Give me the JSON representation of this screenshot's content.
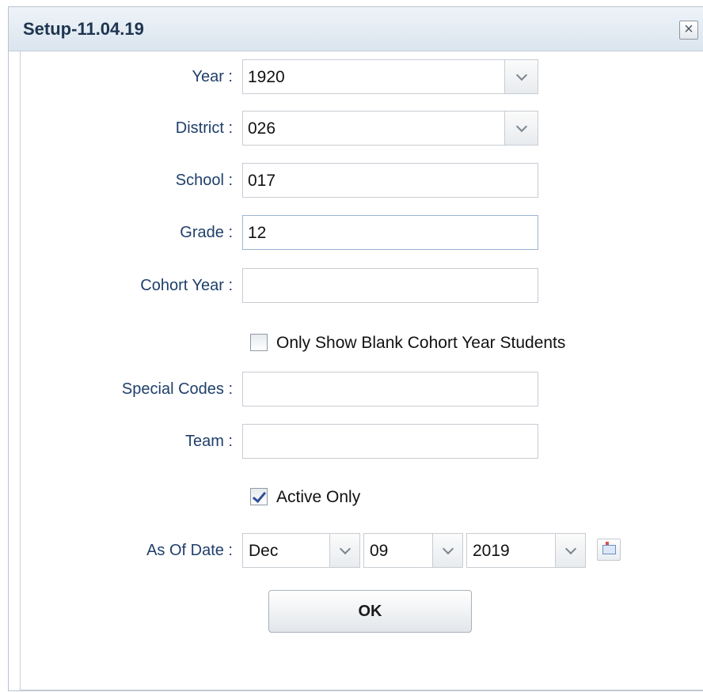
{
  "window": {
    "title": "Setup-11.04.19",
    "close_glyph": "×"
  },
  "form": {
    "year": {
      "label": "Year :",
      "value": "1920"
    },
    "district": {
      "label": "District :",
      "value": "026"
    },
    "school": {
      "label": "School :",
      "value": "017"
    },
    "grade": {
      "label": "Grade :",
      "value": "12"
    },
    "cohort_year": {
      "label": "Cohort Year :",
      "value": ""
    },
    "blank_cohort": {
      "label": "Only Show Blank Cohort Year Students",
      "checked": false
    },
    "special_codes": {
      "label": "Special Codes :",
      "value": ""
    },
    "team": {
      "label": "Team :",
      "value": ""
    },
    "active_only": {
      "label": "Active Only",
      "checked": true
    },
    "as_of_date": {
      "label": "As Of Date :",
      "month": "Dec",
      "day": "09",
      "year": "2019"
    }
  },
  "ok_button": {
    "label": "OK"
  },
  "icons": {
    "dropdown": "chevron-down-icon",
    "calendar": "calendar-icon"
  },
  "colors": {
    "label_text": "#1f3f6a",
    "title_text": "#1e3550",
    "check_mark": "#2f4f9b"
  }
}
